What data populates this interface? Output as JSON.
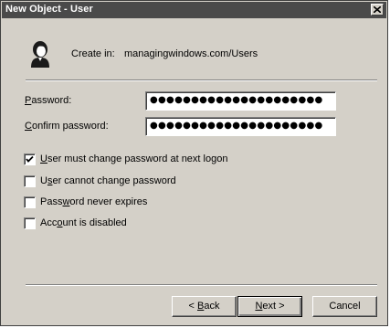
{
  "window": {
    "title": "New Object - User",
    "close_icon": "close-x-icon"
  },
  "header": {
    "icon": "user-icon",
    "create_in_label": "Create in:",
    "create_in_path": "managingwindows.com/Users"
  },
  "fields": {
    "password": {
      "label_access": "P",
      "label_rest": "assword:",
      "value": "●●●●●●●●●●●●●●●●●●●●●"
    },
    "confirm": {
      "label_access": "C",
      "label_rest": "onfirm password:",
      "value": "●●●●●●●●●●●●●●●●●●●●●"
    }
  },
  "options": [
    {
      "label_access": "U",
      "label_rest": "ser must change password at next logon",
      "checked": true
    },
    {
      "label_pre": "U",
      "label_access": "s",
      "label_rest": "er cannot change password",
      "checked": false
    },
    {
      "label_pre": "Pass",
      "label_access": "w",
      "label_rest": "ord never expires",
      "checked": false
    },
    {
      "label_pre": "Acc",
      "label_access": "o",
      "label_rest": "unt is disabled",
      "checked": false
    }
  ],
  "buttons": {
    "back_pre": "< ",
    "back_access": "B",
    "back_rest": "ack",
    "next_access": "N",
    "next_rest": "ext >",
    "cancel": "Cancel"
  }
}
